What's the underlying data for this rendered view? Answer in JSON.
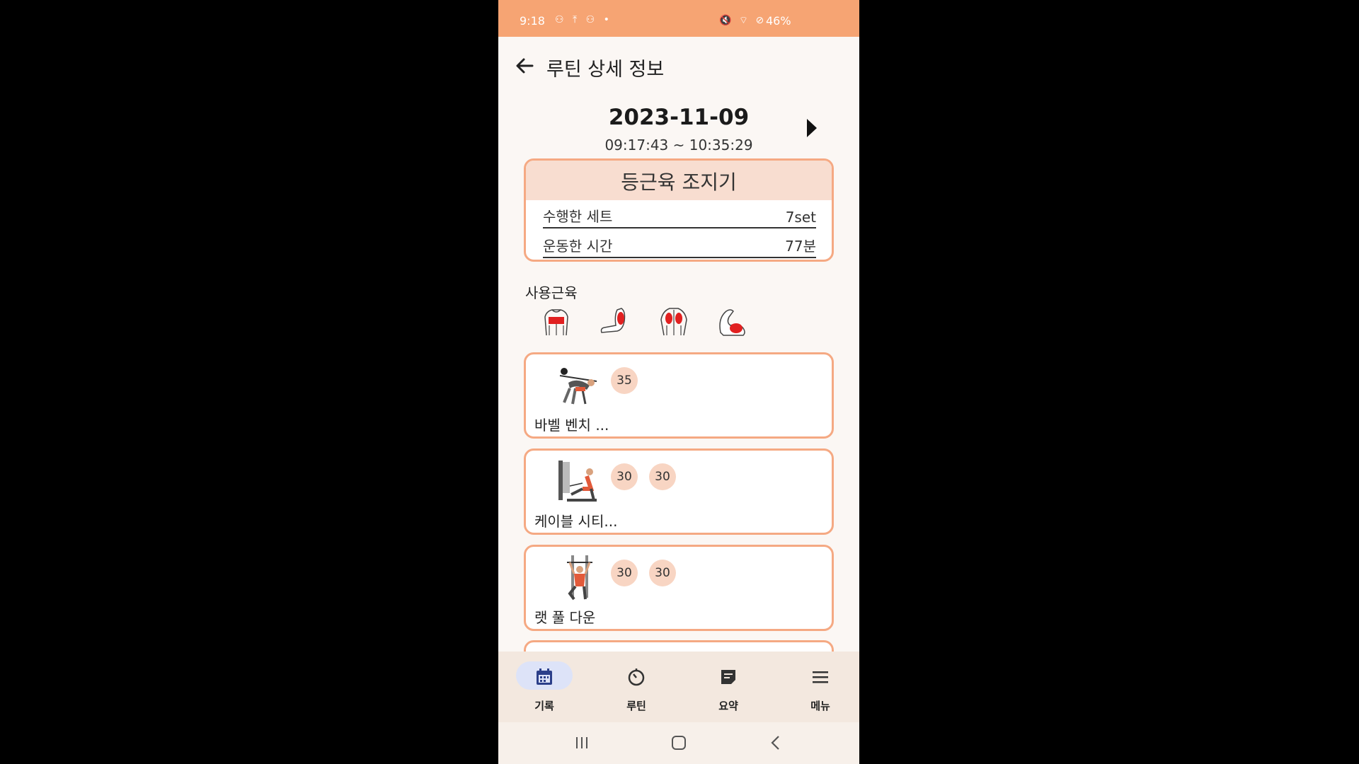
{
  "status_bar": {
    "time": "9:18",
    "left_icons": "⚇ ⤒ ⚇ •",
    "right_icons": "🔇 ⌔ ⊘",
    "battery": "46%"
  },
  "app_bar": {
    "back_icon": "arrow-left-icon",
    "title": "루틴 상세 정보"
  },
  "session": {
    "date": "2023-11-09",
    "time_range": "09:17:43 ~ 10:35:29",
    "next_icon": "triangle-right-icon"
  },
  "summary": {
    "routine_name": "등근육 조지기",
    "rows": [
      {
        "label": "수행한 세트",
        "value": "7set"
      },
      {
        "label": "운동한 시간",
        "value": "77분"
      }
    ]
  },
  "muscles": {
    "label": "사용근육",
    "icons": [
      "back-muscle-icon",
      "bicep-side-icon",
      "trapezius-icon",
      "arm-flex-icon"
    ]
  },
  "exercises": [
    {
      "name": "바벨 벤치 ...",
      "icon": "barbell-bench-icon",
      "sets": [
        "35"
      ]
    },
    {
      "name": "케이블 시티...",
      "icon": "cable-row-icon",
      "sets": [
        "30",
        "30"
      ]
    },
    {
      "name": "랫 풀 다운",
      "icon": "lat-pulldown-icon",
      "sets": [
        "30",
        "30"
      ]
    }
  ],
  "bottom_nav": [
    {
      "label": "기록",
      "icon": "calendar-icon",
      "active": true
    },
    {
      "label": "루틴",
      "icon": "timer-icon",
      "active": false
    },
    {
      "label": "요약",
      "icon": "note-icon",
      "active": false
    },
    {
      "label": "메뉴",
      "icon": "menu-icon",
      "active": false
    }
  ],
  "colors": {
    "status_bar": "#f6a473",
    "card_border": "#f5a983",
    "chip": "#f8d5c3",
    "nav_bg": "#f3e8df",
    "active_pill": "#dde3f8"
  }
}
